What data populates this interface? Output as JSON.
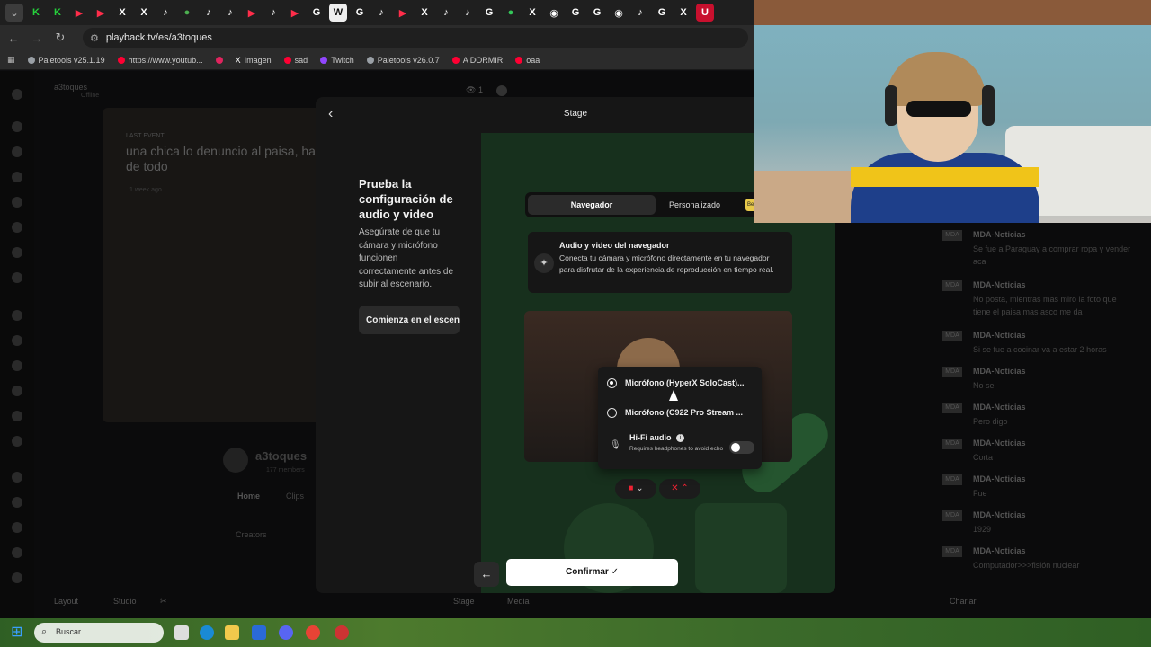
{
  "browser": {
    "url": "playback.tv/es/a3toques",
    "bookmarks": [
      {
        "label": "Paletools v25.1.19",
        "color": "#9aa0a6"
      },
      {
        "label": "https://www.youtub...",
        "color": "#ff0033"
      },
      {
        "label": "",
        "color": "#e0245e"
      },
      {
        "label": "Imagen",
        "color": "#ffffff"
      },
      {
        "label": "sad",
        "color": "#ff0033"
      },
      {
        "label": "Twitch",
        "color": "#9146ff"
      },
      {
        "label": "Paletools v26.0.7",
        "color": "#9aa0a6"
      },
      {
        "label": "A DORMIR",
        "color": "#ff0033"
      },
      {
        "label": "oaa",
        "color": "#ff0033"
      }
    ]
  },
  "background_page": {
    "channel_name": "a3toques",
    "status": "Offline",
    "last_event_label": "LAST EVENT",
    "last_event_title": "una chica lo denuncio al paisa, ha de todo",
    "last_event_time": "1 week ago",
    "viewer_count": "1",
    "profile_name": "a3toques",
    "members": "177 members",
    "tabs": [
      "Home",
      "Clips"
    ],
    "creators_label": "Creators",
    "bottom_bar": [
      "Layout",
      "Studio",
      "Stage",
      "Media",
      "Charlar"
    ]
  },
  "chat": {
    "messages": [
      {
        "badge": "MDA",
        "user": "MDA-Noticias",
        "text": "Se fue a Paraguay a comprar ropa y vender aca"
      },
      {
        "badge": "MDA",
        "user": "MDA-Noticias",
        "text": "No posta, mientras mas miro la foto que tiene el paisa mas asco me da"
      },
      {
        "badge": "MDA",
        "user": "MDA-Noticias",
        "text": "Si se fue a cocinar va a estar 2 horas"
      },
      {
        "badge": "MDA",
        "user": "MDA-Noticias",
        "text": "No se"
      },
      {
        "badge": "MDA",
        "user": "MDA-Noticias",
        "text": "Pero digo"
      },
      {
        "badge": "MDA",
        "user": "MDA-Noticias",
        "text": "Corta"
      },
      {
        "badge": "MDA",
        "user": "MDA-Noticias",
        "text": "Fue"
      },
      {
        "badge": "MDA",
        "user": "MDA-Noticias",
        "text": "1929"
      },
      {
        "badge": "MDA",
        "user": "MDA-Noticias",
        "text": "Computador>>>fisión nuclear"
      }
    ]
  },
  "modal": {
    "title": "Stage",
    "step_title": "Prueba la configuración de audio y video",
    "step_desc": "Asegúrate de que tu cámara y micrófono funcionen correctamente antes de subir al escenario.",
    "start_button": "Comienza en el escenario",
    "segment": {
      "browser": "Navegador",
      "custom": "Personalizado",
      "badge": "Be"
    },
    "info": {
      "title": "Audio y video del navegador",
      "desc": "Conecta tu cámara y micrófono directamente en tu navegador para disfrutar de la experiencia de reproducción en tiempo real."
    },
    "mic_options": [
      {
        "label": "Micrófono (HyperX SoloCast)...",
        "selected": true
      },
      {
        "label": "Micrófono (C922 Pro Stream ...",
        "selected": false
      }
    ],
    "hifi": {
      "title": "Hi-Fi audio",
      "desc": "Requires headphones to avoid echo",
      "enabled": false
    },
    "confirm_button": "Confirmar ✓"
  },
  "taskbar": {
    "search_placeholder": "Buscar"
  },
  "colors": {
    "accent_green": "#17301d",
    "confirm_bg": "#ffffff",
    "muted_red": "#e22233"
  }
}
